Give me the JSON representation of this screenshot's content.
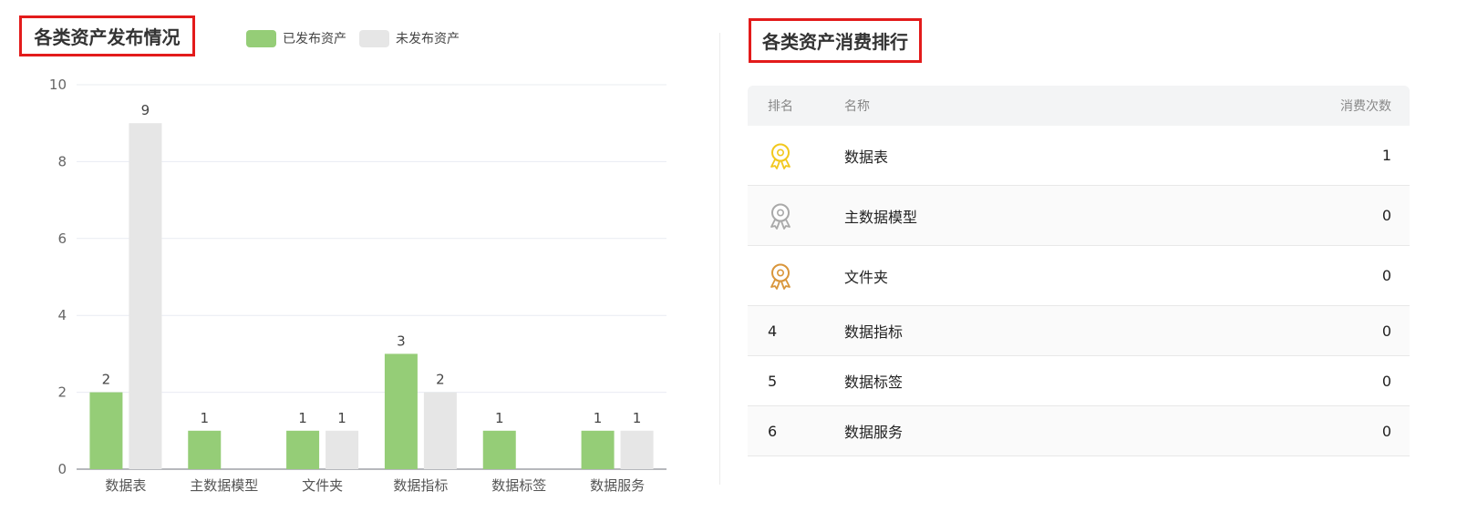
{
  "left": {
    "title": "各类资产发布情况",
    "legend": [
      {
        "label": "已发布资产",
        "color": "#95cd77"
      },
      {
        "label": "未发布资产",
        "color": "#e6e6e6"
      }
    ]
  },
  "chart_data": {
    "type": "bar",
    "title": "各类资产发布情况",
    "categories": [
      "数据表",
      "主数据模型",
      "文件夹",
      "数据指标",
      "数据标签",
      "数据服务"
    ],
    "series": [
      {
        "name": "已发布资产",
        "color": "#95cd77",
        "values": [
          2,
          1,
          1,
          3,
          1,
          1
        ]
      },
      {
        "name": "未发布资产",
        "color": "#e6e6e6",
        "values": [
          9,
          0,
          1,
          2,
          0,
          1
        ]
      }
    ],
    "ylim": [
      0,
      10
    ],
    "yticks": [
      0,
      2,
      4,
      6,
      8,
      10
    ],
    "grid": true,
    "legend_position": "top",
    "xlabel": "",
    "ylabel": ""
  },
  "right": {
    "title": "各类资产消费排行",
    "table": {
      "headers": {
        "rank": "排名",
        "name": "名称",
        "count": "消费次数"
      },
      "rows": [
        {
          "rank": "",
          "medal": "gold-medal-icon",
          "medal_color": "#f2c81e",
          "name": "数据表",
          "count": "1"
        },
        {
          "rank": "",
          "medal": "silver-medal-icon",
          "medal_color": "#a9a9a9",
          "name": "主数据模型",
          "count": "0"
        },
        {
          "rank": "",
          "medal": "bronze-medal-icon",
          "medal_color": "#d9963b",
          "name": "文件夹",
          "count": "0"
        },
        {
          "rank": "4",
          "medal": "",
          "name": "数据指标",
          "count": "0"
        },
        {
          "rank": "5",
          "medal": "",
          "name": "数据标签",
          "count": "0"
        },
        {
          "rank": "6",
          "medal": "",
          "name": "数据服务",
          "count": "0"
        }
      ]
    }
  }
}
